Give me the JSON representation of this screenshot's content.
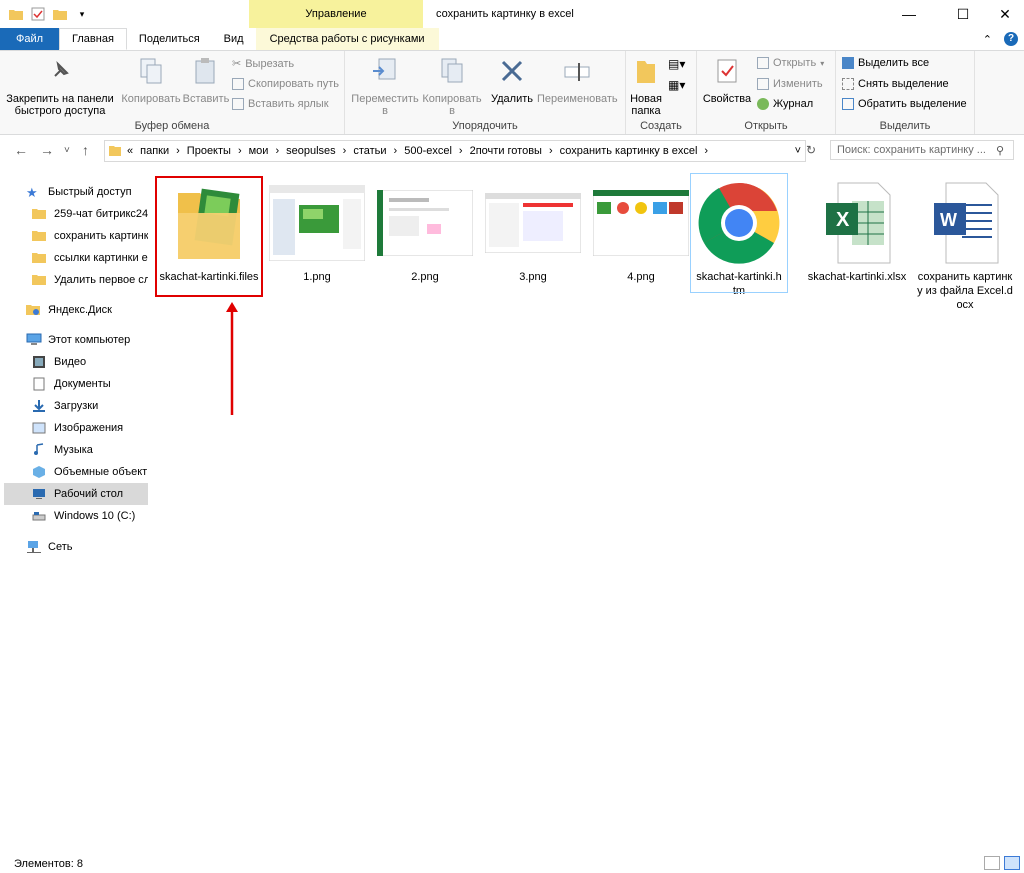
{
  "window": {
    "title": "сохранить картинку в excel",
    "context_tab": "Управление",
    "minimize": "—",
    "maximize": "☐",
    "close": "✕"
  },
  "tabs": {
    "file": "Файл",
    "home": "Главная",
    "share": "Поделиться",
    "view": "Вид",
    "picture_tools": "Средства работы с рисунками"
  },
  "ribbon": {
    "clipboard": {
      "label": "Буфер обмена",
      "pin": "Закрепить на панели быстрого доступа",
      "copy": "Копировать",
      "paste": "Вставить",
      "cut": "Вырезать",
      "copy_path": "Скопировать путь",
      "paste_shortcut": "Вставить ярлык"
    },
    "organize": {
      "label": "Упорядочить",
      "move": "Переместить в",
      "copy_to": "Копировать в",
      "delete": "Удалить",
      "rename": "Переименовать"
    },
    "new": {
      "label": "Создать",
      "new_folder": "Новая папка"
    },
    "open": {
      "label": "Открыть",
      "properties": "Свойства",
      "open": "Открыть",
      "edit": "Изменить",
      "history": "Журнал"
    },
    "select": {
      "label": "Выделить",
      "select_all": "Выделить все",
      "select_none": "Снять выделение",
      "invert": "Обратить выделение"
    }
  },
  "address": {
    "breadcrumbs": [
      "«",
      "папки",
      "Проекты",
      "мои",
      "seopulses",
      "статьи",
      "500-excel",
      "2почти готовы",
      "сохранить картинку в excel"
    ],
    "search_placeholder": "Поиск: сохранить картинку ..."
  },
  "navpane": {
    "quick_access": "Быстрый доступ",
    "pinned": [
      "259-чат битрикс24",
      "сохранить картинк",
      "ссылки картинки е",
      "Удалить первое сл"
    ],
    "yandex": "Яндекс.Диск",
    "this_pc": "Этот компьютер",
    "pc_items": [
      "Видео",
      "Документы",
      "Загрузки",
      "Изображения",
      "Музыка",
      "Объемные объекты",
      "Рабочий стол",
      "Windows 10 (C:)"
    ],
    "network": "Сеть"
  },
  "files": [
    {
      "name": "skachat-kartinki.files",
      "type": "folder"
    },
    {
      "name": "1.png",
      "type": "image"
    },
    {
      "name": "2.png",
      "type": "image"
    },
    {
      "name": "3.png",
      "type": "image"
    },
    {
      "name": "4.png",
      "type": "image"
    },
    {
      "name": "skachat-kartinki.htm",
      "type": "chrome"
    },
    {
      "name": "skachat-kartinki.xlsx",
      "type": "excel"
    },
    {
      "name": "сохранить картинку из файла Excel.docx",
      "type": "word"
    }
  ],
  "status": {
    "items": "Элементов: 8"
  },
  "colors": {
    "file_tab": "#1a6ab8",
    "highlight": "#e00000",
    "context_tab": "#f7f29c"
  }
}
